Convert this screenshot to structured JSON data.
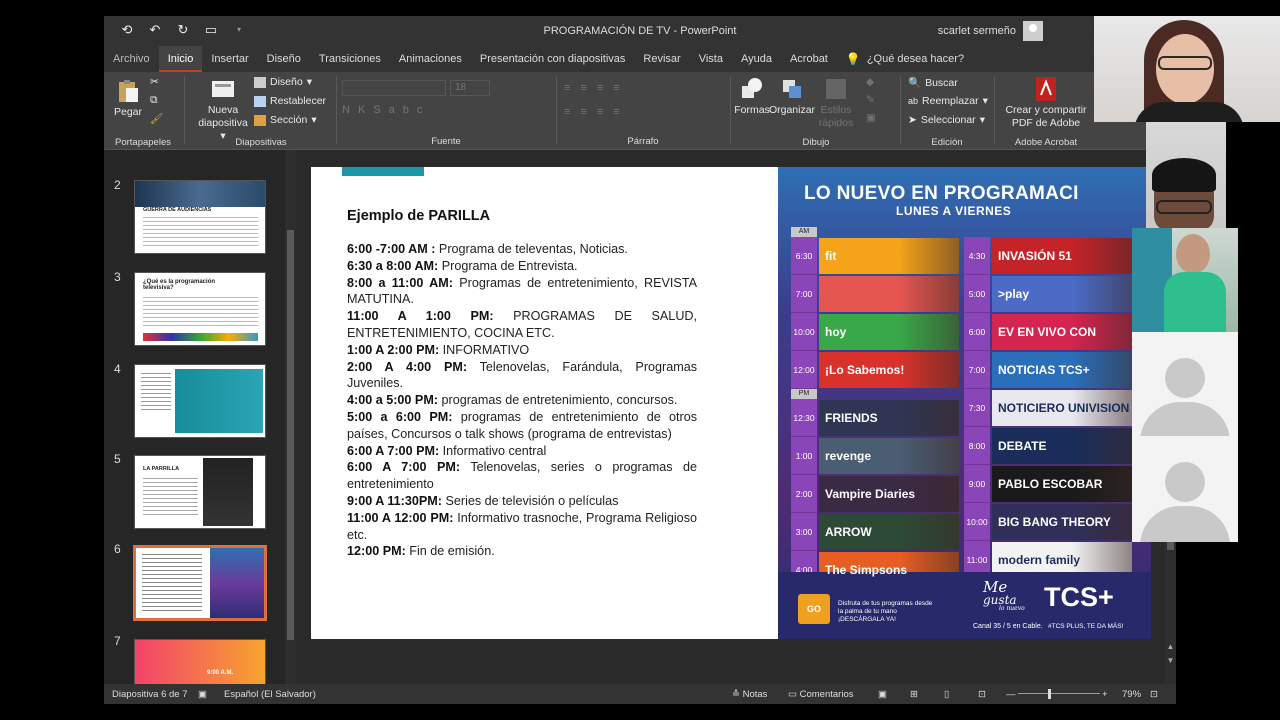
{
  "window": {
    "doc_title": "PROGRAMACIÓN DE TV",
    "app_name": "PowerPoint",
    "user_name": "scarlet sermeño"
  },
  "tabs": [
    "Archivo",
    "Inicio",
    "Insertar",
    "Diseño",
    "Transiciones",
    "Animaciones",
    "Presentación con diapositivas",
    "Revisar",
    "Vista",
    "Ayuda",
    "Acrobat"
  ],
  "active_tab": "Inicio",
  "tell_me": "¿Qué desea hacer?",
  "ribbon": {
    "clipboard": {
      "paste": "Pegar",
      "label": "Portapapeles"
    },
    "slides": {
      "new_slide_1": "Nueva",
      "new_slide_2": "diapositiva",
      "layout": "Diseño",
      "reset": "Restablecer",
      "section": "Sección",
      "label": "Diapositivas"
    },
    "font": {
      "label": "Fuente",
      "size": "18"
    },
    "paragraph": {
      "label": "Párrafo"
    },
    "drawing": {
      "shapes": "Formas",
      "arrange": "Organizar",
      "quick_styles_1": "Estilos",
      "quick_styles_2": "rápidos",
      "label": "Dibujo"
    },
    "editing": {
      "find": "Buscar",
      "replace": "Reemplazar",
      "select": "Seleccionar",
      "label": "Edición"
    },
    "acrobat": {
      "create_1": "Crear y compartir",
      "create_2": "PDF de Adobe",
      "label": "Adobe Acrobat"
    }
  },
  "thumbnails": [
    {
      "num": "2",
      "title": "GUERRA DE AUDIENCIAS"
    },
    {
      "num": "3",
      "title": "¿Qué es la programación televisiva?"
    },
    {
      "num": "4",
      "title": ""
    },
    {
      "num": "5",
      "title": "LA PARRILLA"
    },
    {
      "num": "6",
      "title": ""
    },
    {
      "num": "7",
      "title": "9:00 A.M."
    }
  ],
  "slide": {
    "title": "Ejemplo de PARILLA",
    "schedule": [
      {
        "time": "6:00 -7:00 AM :",
        "text": " Programa de televentas,  Noticias."
      },
      {
        "time": "6:30 a 8:00 AM:",
        "text": " Programa de Entrevista."
      },
      {
        "time": "8:00 a 11:00 AM:",
        "text": " Programas de entretenimiento, REVISTA MATUTINA."
      },
      {
        "time": "11:00 A 1:00 PM:",
        "text": " PROGRAMAS DE SALUD, ENTRETENIMIENTO, COCINA ETC."
      },
      {
        "time": "1:00 A 2:00 PM:",
        "text": "  INFORMATIVO"
      },
      {
        "time": "2:00 A 4:00 PM:",
        "text": " Telenovelas, Farándula, Programas Juveniles."
      },
      {
        "time": "4:00 a 5:00 PM:",
        "text": " programas de entretenimiento, concursos."
      },
      {
        "time": "5:00 a 6:00 PM:",
        "text": " programas de entretenimiento de otros países, Concursos o talk shows (programa de entrevistas)"
      },
      {
        "time": "6:00 A 7:00 PM:",
        "text": " Informativo central"
      },
      {
        "time": "6:00 A 7:00 PM:",
        "text": " Telenovelas, series o programas de entretenimiento"
      },
      {
        "time": "9:00 A 11:30PM:",
        "text": " Series de televisión o películas"
      },
      {
        "time": "11:00 A 12:00 PM:",
        "text": " Informativo trasnoche, Programa Religioso etc."
      },
      {
        "time": "12:00 PM:",
        "text": " Fin de emisión."
      }
    ],
    "poster": {
      "title": "LO NUEVO EN PROGRAMACI",
      "subtitle": "LUNES A VIERNES",
      "am": "AM",
      "pm": "PM",
      "left": [
        {
          "time": "6:30",
          "prog": "fit",
          "color": "#f4a31b"
        },
        {
          "time": "7:00",
          "prog": "",
          "color": "#e4564f"
        },
        {
          "time": "10:00",
          "prog": "hoy",
          "color": "#39a84a"
        },
        {
          "time": "12:00",
          "prog": "¡Lo Sabemos!",
          "color": "#d8322a"
        },
        {
          "time": "12:30",
          "prog": "FRIENDS",
          "color": "#2f3553"
        },
        {
          "time": "1:00",
          "prog": "revenge",
          "color": "#4b5d73"
        },
        {
          "time": "2:00",
          "prog": "Vampire Diaries",
          "color": "#3b2a44"
        },
        {
          "time": "3:00",
          "prog": "ARROW",
          "color": "#2d4a36"
        },
        {
          "time": "4:00",
          "prog": "The Simpsons",
          "color": "#e75e22"
        }
      ],
      "right": [
        {
          "time": "4:30",
          "prog": "INVASIÓN 51",
          "color": "#c5232a"
        },
        {
          "time": "5:00",
          "prog": ">play",
          "color": "#4b6bc7"
        },
        {
          "time": "6:00",
          "prog": "EV EN VIVO CON",
          "color": "#d4244f"
        },
        {
          "time": "7:00",
          "prog": "NOTICIAS TCS+",
          "color": "#2a6fb8"
        },
        {
          "time": "7:30",
          "prog": "NOTICIERO UNIVISION",
          "color": "#e8e8ee"
        },
        {
          "time": "8:00",
          "prog": "DEBATE",
          "color": "#1a2d5a"
        },
        {
          "time": "9:00",
          "prog": "PABLO ESCOBAR",
          "color": "#1a1a1a"
        },
        {
          "time": "10:00",
          "prog": "BIG BANG THEORY",
          "color": "#2f2f5a"
        },
        {
          "time": "11:00",
          "prog": "modern family",
          "color": "#f2f2f2"
        }
      ],
      "footer_app": "GO",
      "footer_text": "Disfruta de tus programas desde la palma de tu mano ¡DESCÁRGALA YA!",
      "slogan_1": "Me",
      "slogan_2": "gusta",
      "slogan_3": "lo nuevo",
      "channel": "Canal 35 / 5 en Cable.",
      "brand": "TCS+",
      "brand_tag": "#TCS PLUS, TE DA MÁS!"
    }
  },
  "statusbar": {
    "slide_info": "Diapositiva 6 de 7",
    "language": "Español (El Salvador)",
    "notes": "Notas",
    "comments": "Comentarios",
    "zoom": "79%"
  },
  "colors": {
    "accent": "#c43e1c",
    "selected_thumb": "#e0703b",
    "teal": "#1c95a8"
  }
}
